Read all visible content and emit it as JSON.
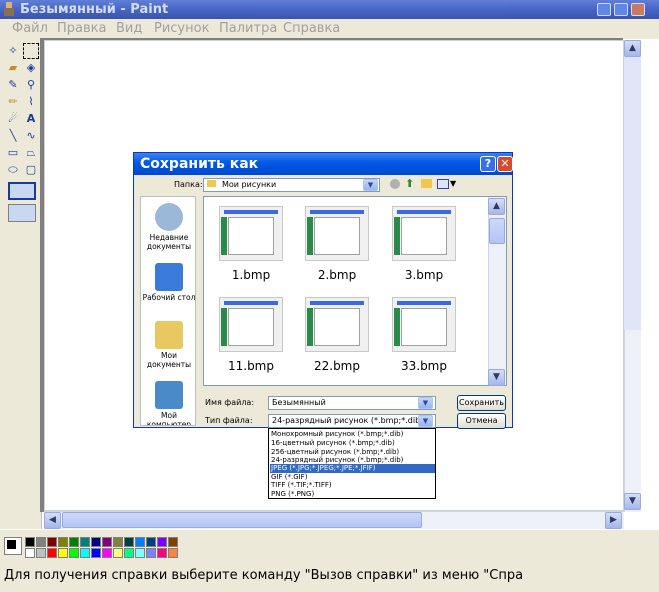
{
  "window": {
    "title": "Безымянный - Paint"
  },
  "menu": [
    "Файл",
    "Правка",
    "Вид",
    "Рисунок",
    "Палитра",
    "Справка"
  ],
  "tools": [
    "free-select",
    "rect-select",
    "eraser",
    "fill",
    "color-picker",
    "magnifier",
    "pencil",
    "brush",
    "airbrush",
    "text",
    "line",
    "curve",
    "rectangle",
    "polygon",
    "ellipse",
    "rounded-rect"
  ],
  "palette": [
    "#000000",
    "#808080",
    "#800000",
    "#808000",
    "#008000",
    "#008080",
    "#000080",
    "#800080",
    "#808040",
    "#004040",
    "#0080ff",
    "#004080",
    "#8000ff",
    "#804000",
    "#ffffff",
    "#c0c0c0",
    "#ff0000",
    "#ffff00",
    "#00ff00",
    "#00ffff",
    "#0000ff",
    "#ff00ff",
    "#ffff80",
    "#00ff80",
    "#80ffff",
    "#8080ff",
    "#ff0080",
    "#ff8040"
  ],
  "status": {
    "text": "Для получения справки выберите команду \"Вызов справки\" из меню \"Спра"
  },
  "dialog": {
    "title": "Сохранить как",
    "folder_label": "Папка:",
    "folder_value": "Мои рисунки",
    "places": [
      {
        "label": "Недавние документы",
        "color": "#9cb8d8"
      },
      {
        "label": "Рабочий стол",
        "color": "#3a7ad8"
      },
      {
        "label": "Мои документы",
        "color": "#e8c860"
      },
      {
        "label": "Мой компьютер",
        "color": "#4a8ac8"
      }
    ],
    "files": [
      "1.bmp",
      "2.bmp",
      "3.bmp",
      "11.bmp",
      "22.bmp",
      "33.bmp"
    ],
    "filename_label": "Имя файла:",
    "filename_value": "Безымянный",
    "filetype_label": "Тип файла:",
    "filetype_value": "24-разрядный рисунок (*.bmp;*.dib)",
    "save_button": "Сохранить",
    "cancel_button": "Отмена",
    "filetype_options": [
      "Монохромный рисунок (*.bmp;*.dib)",
      "16-цветный рисунок (*.bmp;*.dib)",
      "256-цветный рисунок (*.bmp;*.dib)",
      "24-разрядный рисунок (*.bmp;*.dib)",
      "JPEG (*.JPG;*.JPEG;*.JPE;*.JFIF)",
      "GIF (*.GIF)",
      "TIFF (*.TIF;*.TIFF)",
      "PNG (*.PNG)"
    ],
    "selected_option_index": 4
  }
}
